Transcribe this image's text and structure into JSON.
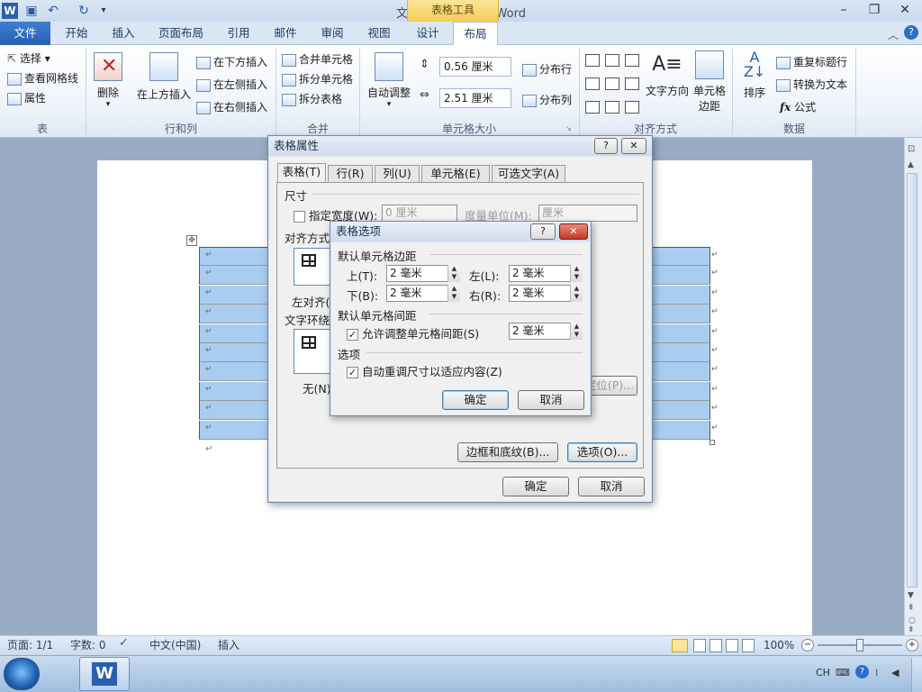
{
  "window": {
    "title": "文档1 - Microsoft Word",
    "context_tab": "表格工具"
  },
  "ribbon_tabs": [
    "文件",
    "开始",
    "插入",
    "页面布局",
    "引用",
    "邮件",
    "审阅",
    "视图",
    "设计",
    "布局"
  ],
  "ribbon": {
    "table_group": {
      "label": "表",
      "select": "选择",
      "gridlines": "查看网格线",
      "properties": "属性"
    },
    "rows_cols_group": {
      "label": "行和列",
      "delete": "删除",
      "insert_above": "在上方插入",
      "insert_below": "在下方插入",
      "insert_left": "在左侧插入",
      "insert_right": "在右侧插入"
    },
    "merge_group": {
      "label": "合并",
      "merge_cells": "合并单元格",
      "split_cells": "拆分单元格",
      "split_table": "拆分表格"
    },
    "cell_size_group": {
      "label": "单元格大小",
      "autofit": "自动调整",
      "height": "0.56 厘米",
      "width": "2.51 厘米",
      "distribute_rows": "分布行",
      "distribute_cols": "分布列"
    },
    "alignment_group": {
      "label": "对齐方式",
      "text_direction": "文字方向",
      "cell_margins_line1": "单元格",
      "cell_margins_line2": "边距"
    },
    "data_group": {
      "label": "数据",
      "sort": "排序",
      "repeat_header": "重复标题行",
      "convert_text": "转换为文本",
      "formula": "公式",
      "fx": "fx"
    }
  },
  "table_props_dialog": {
    "title": "表格属性",
    "help": "?",
    "close": "✕",
    "tabs": [
      "表格(T)",
      "行(R)",
      "列(U)",
      "单元格(E)",
      "可选文字(A)"
    ],
    "size_label": "尺寸",
    "specify_width": "指定宽度(W):",
    "width_value": "0 厘米",
    "measure_in": "度量单位(M):",
    "measure_value": "厘米",
    "alignment_label": "对齐方式",
    "align_left": "左对齐(",
    "wrap_label": "文字环绕",
    "wrap_none": "无(N)",
    "positioning": "定位(P)...",
    "borders_btn": "边框和底纹(B)...",
    "options_btn": "选项(O)...",
    "ok": "确定",
    "cancel": "取消"
  },
  "table_options_dialog": {
    "title": "表格选项",
    "help": "?",
    "close": "✕",
    "default_margins": "默认单元格边距",
    "top_label": "上(T):",
    "top_value": "2 毫米",
    "left_label": "左(L):",
    "left_value": "2 毫米",
    "bottom_label": "下(B):",
    "bottom_value": "2 毫米",
    "right_label": "右(R):",
    "right_value": "2 毫米",
    "default_spacing": "默认单元格间距",
    "allow_spacing": "允许调整单元格间距(S)",
    "spacing_value": "2 毫米",
    "options_label": "选项",
    "auto_resize": "自动重调尺寸以适应内容(Z)",
    "ok": "确定",
    "cancel": "取消"
  },
  "statusbar": {
    "page": "页面: 1/1",
    "words": "字数: 0",
    "language": "中文(中国)",
    "mode": "插入",
    "zoom": "100%"
  },
  "taskbar": {
    "lang": "CH"
  },
  "table": {
    "rows": 10,
    "para_mark": "↵"
  },
  "colors": {
    "accent": "#2a5fb0",
    "table_fill": "#a9cdf0",
    "context_tab": "#f5cd55"
  }
}
